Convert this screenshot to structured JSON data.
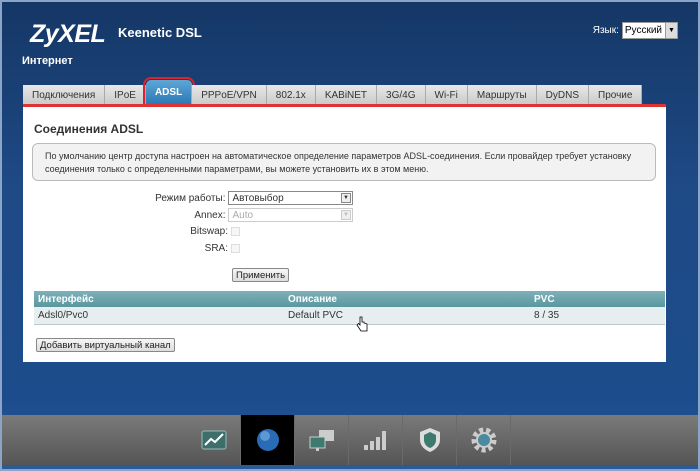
{
  "header": {
    "logo": "ZyXEL",
    "model": "Keenetic DSL",
    "language_label": "Язык:",
    "language_value": "Русский",
    "section": "Интернет"
  },
  "tabs": [
    {
      "label": "Подключения"
    },
    {
      "label": "IPoE"
    },
    {
      "label": "ADSL",
      "active": true
    },
    {
      "label": "PPPoE/VPN"
    },
    {
      "label": "802.1x"
    },
    {
      "label": "KABiNET"
    },
    {
      "label": "3G/4G"
    },
    {
      "label": "Wi-Fi"
    },
    {
      "label": "Маршруты"
    },
    {
      "label": "DyDNS"
    },
    {
      "label": "Прочие"
    }
  ],
  "panel": {
    "title": "Соединения ADSL",
    "info": "По умолчанию центр доступа настроен на автоматическое определение параметров ADSL-соединения. Если провайдер требует установку соединения только с определенными параметрами, вы можете установить их в этом меню.",
    "mode_label": "Режим работы:",
    "mode_value": "Автовыбор",
    "annex_label": "Annex:",
    "annex_value": "Auto",
    "bitswap_label": "Bitswap:",
    "bitswap_checked": false,
    "sra_label": "SRA:",
    "sra_checked": false,
    "apply_label": "Применить",
    "table": {
      "headers": [
        "Интерфейс",
        "Описание",
        "PVC"
      ],
      "rows": [
        [
          "Adsl0/Pvc0",
          "Default PVC",
          "8 / 35"
        ]
      ]
    },
    "add_label": "Добавить виртуальный канал"
  },
  "bottom_nav": [
    {
      "icon": "chart-icon"
    },
    {
      "icon": "globe-icon",
      "active": true
    },
    {
      "icon": "network-computers-icon"
    },
    {
      "icon": "signal-bars-icon"
    },
    {
      "icon": "shield-icon"
    },
    {
      "icon": "gear-icon"
    }
  ],
  "colors": {
    "accent_tab": "#2c79b5",
    "highlight": "#e0202a",
    "table_header": "#5a979f"
  }
}
